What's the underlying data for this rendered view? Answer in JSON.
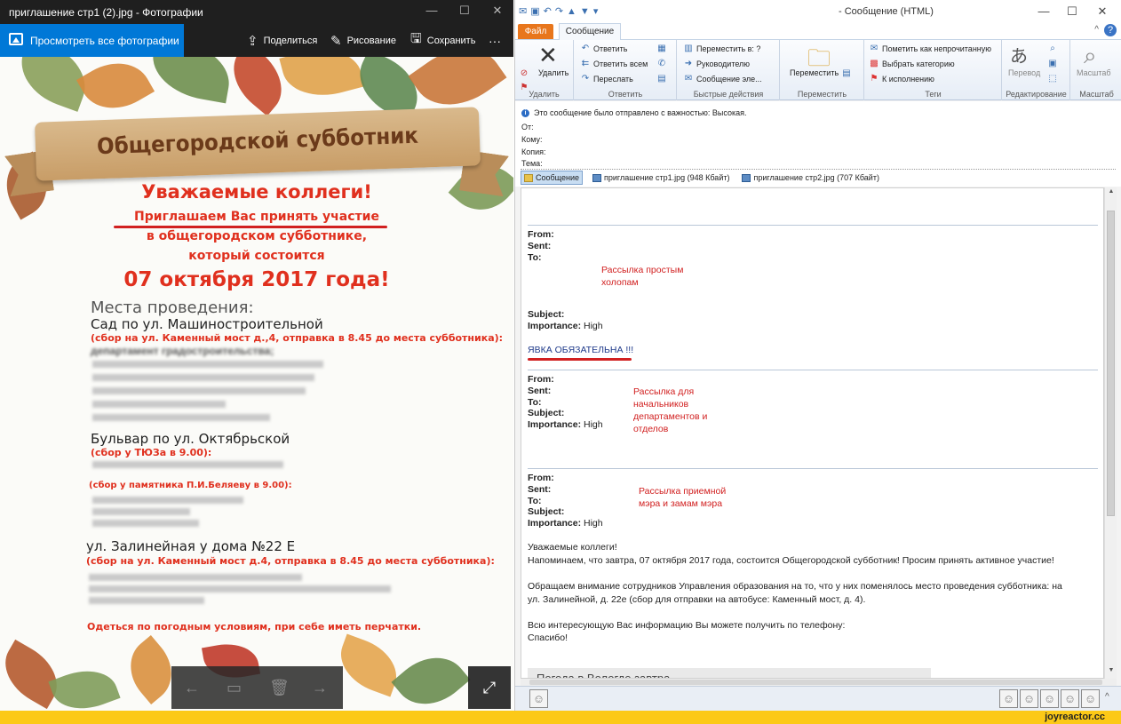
{
  "photos": {
    "title": "приглашение стр1 (2).jpg - Фотографии",
    "view_all": "Просмотреть все фотографии",
    "share": "Поделиться",
    "draw": "Рисование",
    "save": "Сохранить",
    "more": "···",
    "image": {
      "banner": "Общегородской субботник",
      "greeting": "Уважаемые коллеги!",
      "invite1": "Приглашаем Вас принять участие",
      "invite2": "в общегородском субботнике,",
      "invite3": "который состоится",
      "date": "07 октября 2017 года!",
      "places_title": "Места проведения:",
      "place1": "Сад по ул. Машиностроительной",
      "place1_note": "(сбор на ул. Каменный мост д.,4, отправка в 8.45 до места субботника):",
      "place1_dept": "департамент градостроительства;",
      "place2": "Бульвар по ул. Октябрьской",
      "place2_note": "(сбор у ТЮЗа  в 9.00):",
      "place2_note2": "(сбор  у памятника П.И.Беляеву в 9.00):",
      "place3": "ул. Залинейная у дома №22 Е",
      "place3_note": "(сбор на ул. Каменный мост д.4, отправка в 8.45 до места субботника):",
      "dress": "Одеться по погодным условиям, при себе иметь перчатки."
    }
  },
  "outlook": {
    "title": "Сообщение (HTML)",
    "tabs": {
      "file": "Файл",
      "message": "Сообщение"
    },
    "ribbon": {
      "delete": "Удалить",
      "reply": "Ответить",
      "reply_all": "Ответить всем",
      "forward": "Переслать",
      "move_to": "Переместить в: ?",
      "to_manager": "Руководителю",
      "email_team": "Сообщение эле...",
      "move": "Переместить",
      "mark_unread": "Пометить как непрочитанную",
      "categorize": "Выбрать категорию",
      "followup": "К исполнению",
      "translate": "Перевод",
      "zoom": "Масштаб",
      "groups": {
        "delete": "Удалить",
        "respond": "Ответить",
        "quick": "Быстрые действия",
        "move": "Переместить",
        "tags": "Теги",
        "editing": "Редактирование",
        "zoom": "Масштаб"
      }
    },
    "importance_note": "Это сообщение было отправлено с важностью: Высокая.",
    "header": {
      "from": "От:",
      "to": "Кому:",
      "cc": "Копия:",
      "subject": "Тема:"
    },
    "attachments": [
      "Сообщение",
      "приглашение стр1.jpg (948 Кбайт)",
      "приглашение стр2.jpg (707 Кбайт)"
    ],
    "body": {
      "from": "From:",
      "sent": "Sent:",
      "to": "To:",
      "subject": "Subject:",
      "importance": "Importance:",
      "high": "High",
      "annot1": "Рассылка простым холопам",
      "mandatory": "ЯВКА ОБЯЗАТЕЛЬНА !!!",
      "annot2": "Рассылка для начальников департаментов и отделов",
      "annot3": "Рассылка приемной мэра и замам мэра",
      "p1": "Уважаемые коллеги!",
      "p2": "Напоминаем, что завтра, 07 октября 2017 года, состоится Общегородской субботник! Просим принять активное участие!",
      "p3a": "Обращаем внимание сотрудников Управления образования на то, что у них поменялось место проведения субботника: на",
      "p3b": "ул. Залинейной, д. 22е (сбор для отправки на автобусе: Каменный мост, д. 4).",
      "p4": "Всю интересующую Вас информацию Вы можете получить по телефону:",
      "p5": "Спасибо!",
      "sig": "Погода в Вологде завтра"
    }
  },
  "footer": {
    "site": "joyreactor.cc"
  },
  "colors": {
    "accent": "#0078d7",
    "file_tab": "#e8761c",
    "annotation": "#d12020",
    "footer": "#fcc917"
  }
}
